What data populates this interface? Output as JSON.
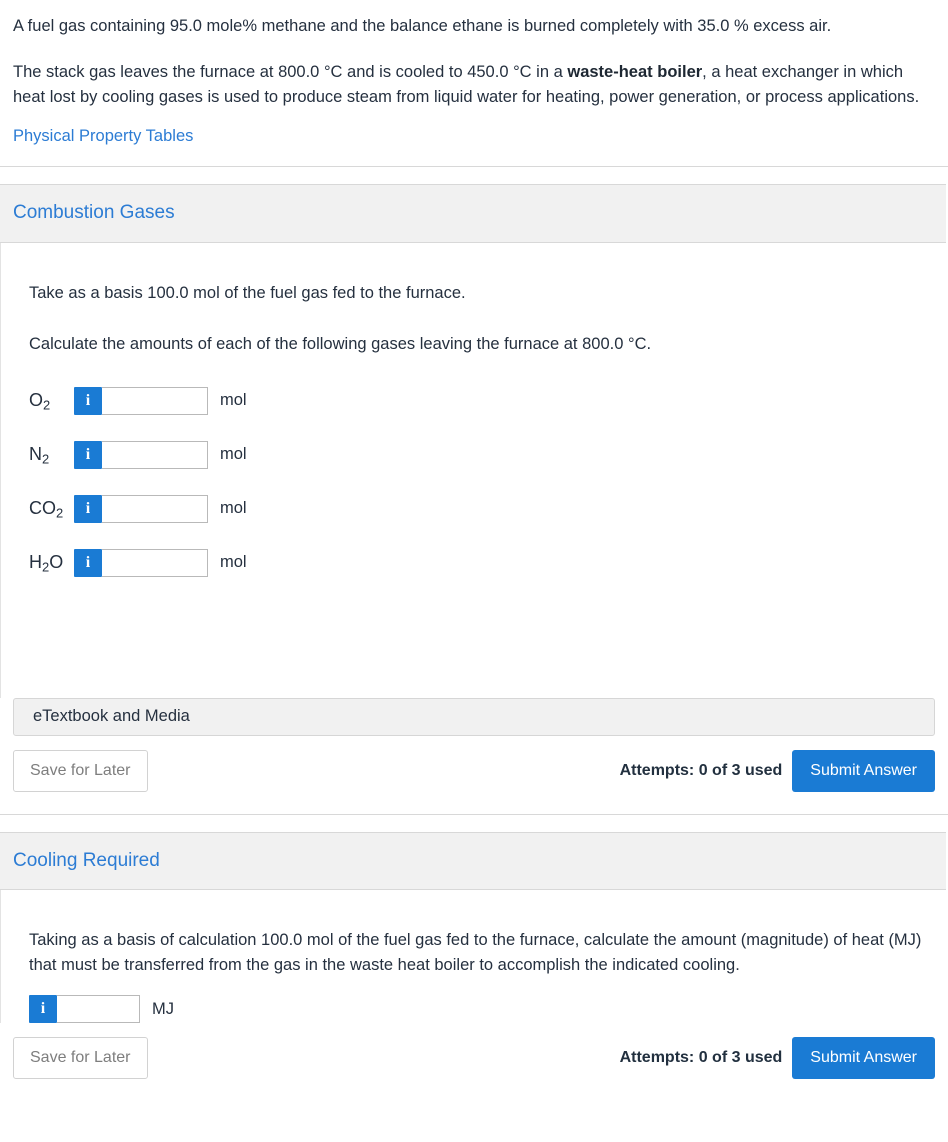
{
  "problem": {
    "paragraph1": "A fuel gas containing 95.0 mole% methane and the balance ethane is burned completely with 35.0 % excess air.",
    "paragraph2_part1": "The stack gas leaves the furnace at 800.0 °C and is cooled to 450.0 °C in a ",
    "paragraph2_bold": "waste-heat boiler",
    "paragraph2_part2": ", a heat exchanger in which heat lost by cooling gases is used to produce steam from liquid water for heating, power generation, or process applications.",
    "link_label": "Physical Property Tables"
  },
  "section1": {
    "title": "Combustion Gases",
    "statement1": "Take as a basis 100.0 mol of the fuel gas fed to the furnace.",
    "statement2": "Calculate the amounts of each of the following gases leaving the furnace at 800.0 °C.",
    "rows": [
      {
        "symbol": "O",
        "subscript": "2",
        "suffix": "",
        "value": "",
        "placeholder": "",
        "unit": "mol",
        "info_label": "i"
      },
      {
        "symbol": "N",
        "subscript": "2",
        "suffix": "",
        "value": "",
        "placeholder": "",
        "unit": "mol",
        "info_label": "i"
      },
      {
        "symbol": "CO",
        "subscript": "2",
        "suffix": "",
        "value": "",
        "placeholder": "",
        "unit": "mol",
        "info_label": "i"
      },
      {
        "symbol": "H",
        "subscript": "2",
        "suffix": "O",
        "value": "",
        "placeholder": "",
        "unit": "mol",
        "info_label": "i"
      }
    ],
    "etextbook_label": "eTextbook and Media",
    "save_label": "Save for Later",
    "attempts_label": "Attempts: 0 of 3 used",
    "submit_label": "Submit Answer"
  },
  "section2": {
    "title": "Cooling Required",
    "statement": "Taking as a basis of calculation 100.0 mol of the fuel gas fed to the furnace, calculate the amount (magnitude) of heat (MJ) that must be transferred from the gas in the waste heat boiler to accomplish the indicated cooling.",
    "info_label": "i",
    "value": "",
    "placeholder": "",
    "unit": "MJ",
    "save_label": "Save for Later",
    "attempts_label": "Attempts: 0 of 3 used",
    "submit_label": "Submit Answer"
  },
  "colors": {
    "accent_blue": "#1a7bd4",
    "link_blue": "#2c7cd4",
    "header_bg": "#f1f1f1",
    "text": "#25303f",
    "border": "#d8d8d8"
  }
}
